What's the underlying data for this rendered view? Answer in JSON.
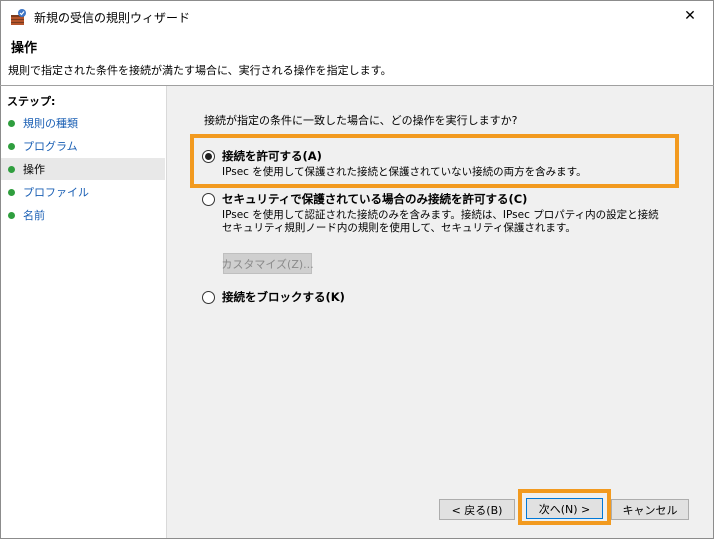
{
  "window": {
    "title": "新規の受信の規則ウィザード",
    "icon": "firewall-rule-icon",
    "close_glyph": "✕"
  },
  "header": {
    "title": "操作",
    "description": "規則で指定された条件を接続が満たす場合に、実行される操作を指定します。"
  },
  "sidebar": {
    "heading": "ステップ:",
    "items": [
      {
        "label": "規則の種類",
        "current": false
      },
      {
        "label": "プログラム",
        "current": false
      },
      {
        "label": "操作",
        "current": true
      },
      {
        "label": "プロファイル",
        "current": false
      },
      {
        "label": "名前",
        "current": false
      }
    ]
  },
  "main": {
    "question": "接続が指定の条件に一致した場合に、どの操作を実行しますか?",
    "options": [
      {
        "label": "接続を許可する(A)",
        "desc_lines": [
          "IPsec を使用して保護された接続と保護されていない接続の両方を含みます。"
        ],
        "checked": true
      },
      {
        "label": "セキュリティで保護されている場合のみ接続を許可する(C)",
        "desc_lines": [
          "IPsec を使用して認証された接続のみを含みます。接続は、IPsec プロパティ内の設定と接続",
          "セキュリティ規則ノード内の規則を使用して、セキュリティ保護されます。"
        ],
        "checked": false
      },
      {
        "label": "接続をブロックする(K)",
        "desc_lines": [],
        "checked": false
      }
    ],
    "customize_label": "カスタマイズ(Z)..."
  },
  "footer": {
    "back_label": "< 戻る(B)",
    "next_label": "次へ(N) >",
    "cancel_label": "キャンセル"
  },
  "colors": {
    "highlight": "#f29a1f",
    "step_dot": "#2f9e3e",
    "link": "#1a5fb4"
  }
}
